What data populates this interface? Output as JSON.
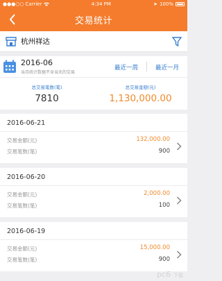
{
  "status_bar": {
    "carrier": "Carrier",
    "time": "4:34 PM",
    "battery": "100%"
  },
  "nav": {
    "title": "交易统计",
    "back_icon": "chevron-left-icon"
  },
  "store": {
    "name": "杭州祥达",
    "store_icon": "storefront-icon",
    "filter_icon": "filter-icon"
  },
  "summary": {
    "month": "2016-06",
    "note": "当月统计数据不含当天的交易",
    "range_buttons": [
      "最近一周",
      "最近一月"
    ],
    "count_label": "总交易笔数(笔)",
    "count_value": "7810",
    "amount_label": "总交易金额(元)",
    "amount_value": "1,130,000.00"
  },
  "days": [
    {
      "date": "2016-06-21",
      "amount_label": "交易金额(元)",
      "amount": "132,000.00",
      "count_label": "交易笔数(笔)",
      "count": "900"
    },
    {
      "date": "2016-06-20",
      "amount_label": "交易金额(元)",
      "amount": "2,000.00",
      "count_label": "交易笔数(笔)",
      "count": "100"
    },
    {
      "date": "2016-06-19",
      "amount_label": "交易金额(元)",
      "amount": "15,000.00",
      "count_label": "交易笔数(笔)",
      "count": "900"
    }
  ],
  "colors": {
    "accent": "#f47c2c",
    "link": "#3a7fcf",
    "amount": "#f08a2c",
    "background": "#efeff2"
  }
}
